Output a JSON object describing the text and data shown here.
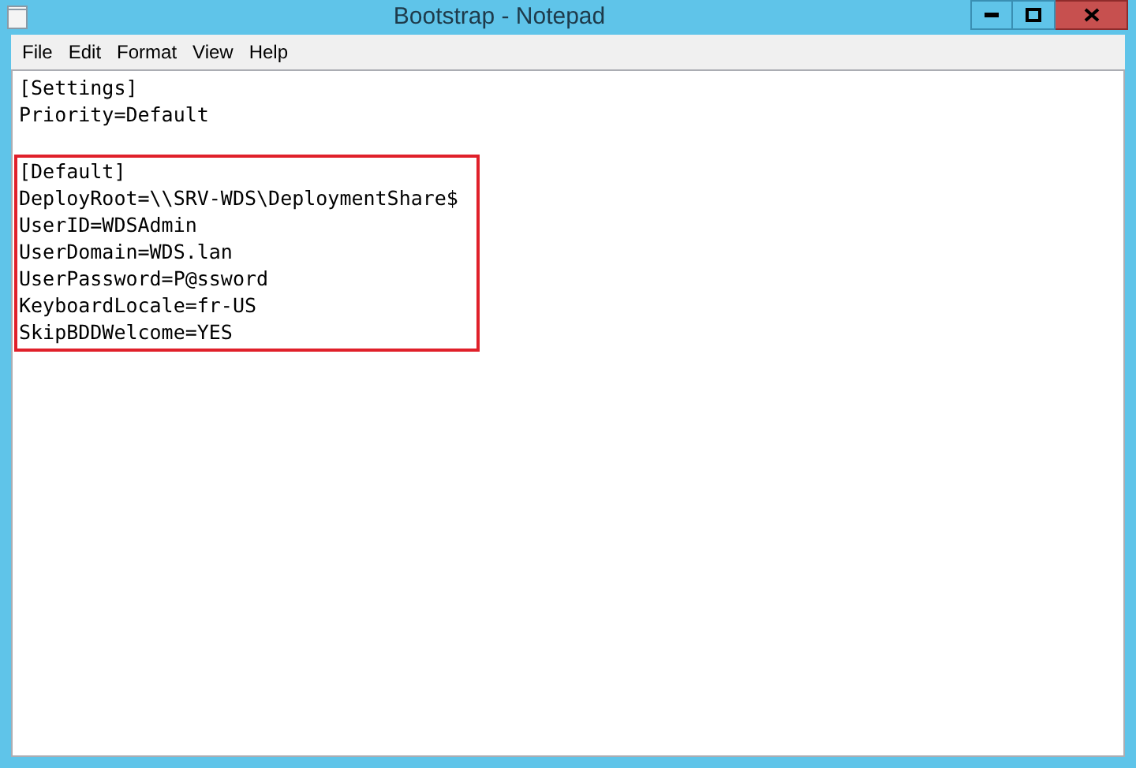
{
  "window": {
    "title": "Bootstrap - Notepad"
  },
  "menu": [
    "File",
    "Edit",
    "Format",
    "View",
    "Help"
  ],
  "editor": {
    "blocks": [
      {
        "highlighted": false,
        "lines": [
          "[Settings]",
          "Priority=Default"
        ]
      },
      {
        "highlighted": true,
        "lines": [
          "[Default]",
          "DeployRoot=\\\\SRV-WDS\\DeploymentShare$",
          "UserID=WDSAdmin",
          "UserDomain=WDS.lan",
          "UserPassword=P@ssword",
          "KeyboardLocale=fr-US",
          "SkipBDDWelcome=YES"
        ]
      }
    ]
  }
}
